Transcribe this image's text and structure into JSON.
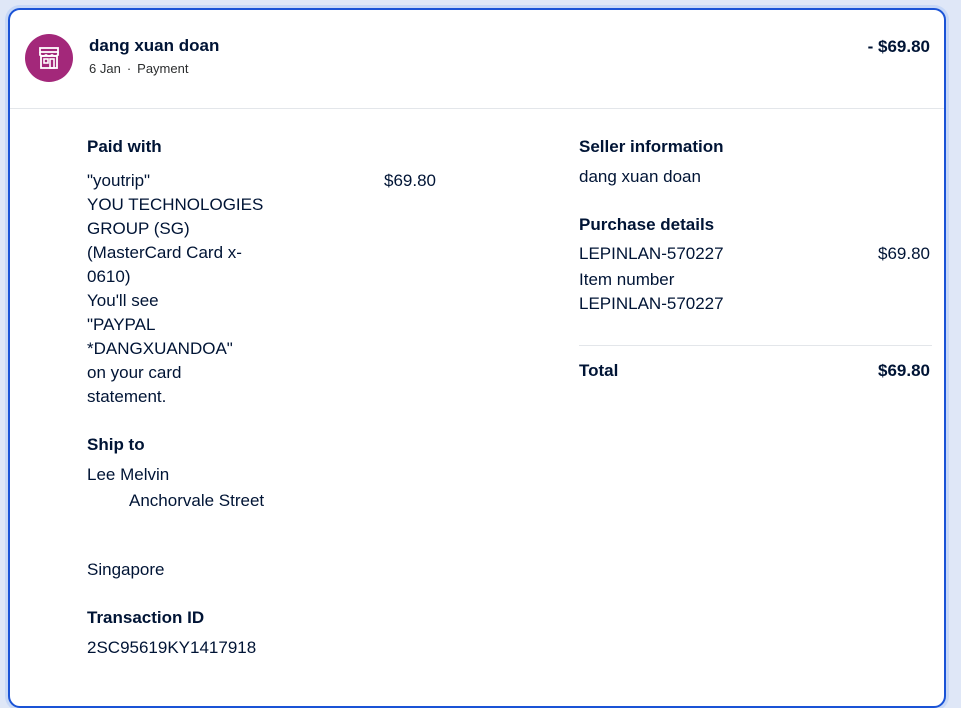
{
  "header": {
    "merchant_name": "dang xuan doan",
    "date": "6 Jan",
    "separator": "·",
    "type": "Payment",
    "amount": "- $69.80",
    "avatar_icon": "storefront-icon",
    "avatar_color": "#a3287a"
  },
  "paid_with": {
    "title": "Paid with",
    "lines": [
      "\"youtrip\"",
      "YOU TECHNOLOGIES",
      "GROUP (SG)",
      "(MasterCard Card x-",
      "0610)",
      "You'll see",
      "\"PAYPAL",
      "*DANGXUANDOA\"",
      "on your card",
      "statement."
    ],
    "amount": "$69.80"
  },
  "ship_to": {
    "title": "Ship to",
    "name": "Lee Melvin",
    "street": "Anchorvale Street",
    "country": "Singapore"
  },
  "transaction": {
    "title": "Transaction ID",
    "id": "2SC95619KY1417918"
  },
  "seller": {
    "title": "Seller information",
    "name": "dang xuan doan"
  },
  "purchase": {
    "title": "Purchase details",
    "item_name": "LEPINLAN-570227",
    "item_amount": "$69.80",
    "item_number_label": "Item number",
    "item_number": "LEPINLAN-570227"
  },
  "total": {
    "label": "Total",
    "amount": "$69.80"
  }
}
